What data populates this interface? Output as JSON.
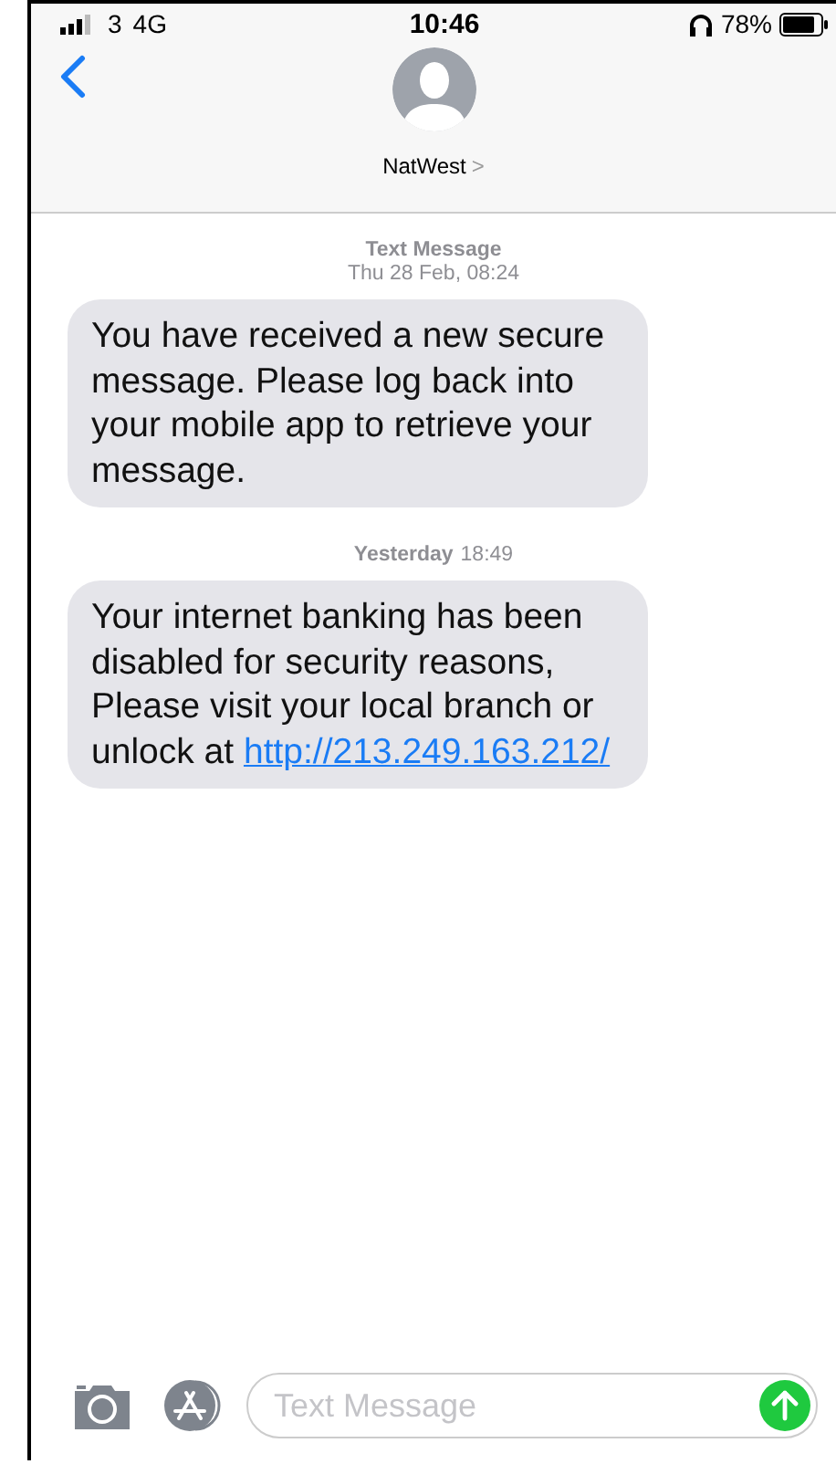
{
  "status_bar": {
    "carrier": "3",
    "network": "4G",
    "time": "10:46",
    "battery": "78%"
  },
  "header": {
    "contact": "NatWest",
    "chevron": ">"
  },
  "messages": [
    {
      "kind": "meta",
      "label": "Text Message",
      "time": "Thu 28 Feb, 08:24"
    },
    {
      "kind": "bubble",
      "text": "You have received a new secure message. Please log back into your mobile app to retrieve your message."
    },
    {
      "kind": "meta",
      "label": "Yesterday",
      "time": "18:49"
    },
    {
      "kind": "bubble",
      "text": "Your internet banking has been disabled for security reasons, Please visit your local branch or unlock at ",
      "link": "http://213.249.163.212/"
    }
  ],
  "composer": {
    "placeholder": "Text Message"
  }
}
